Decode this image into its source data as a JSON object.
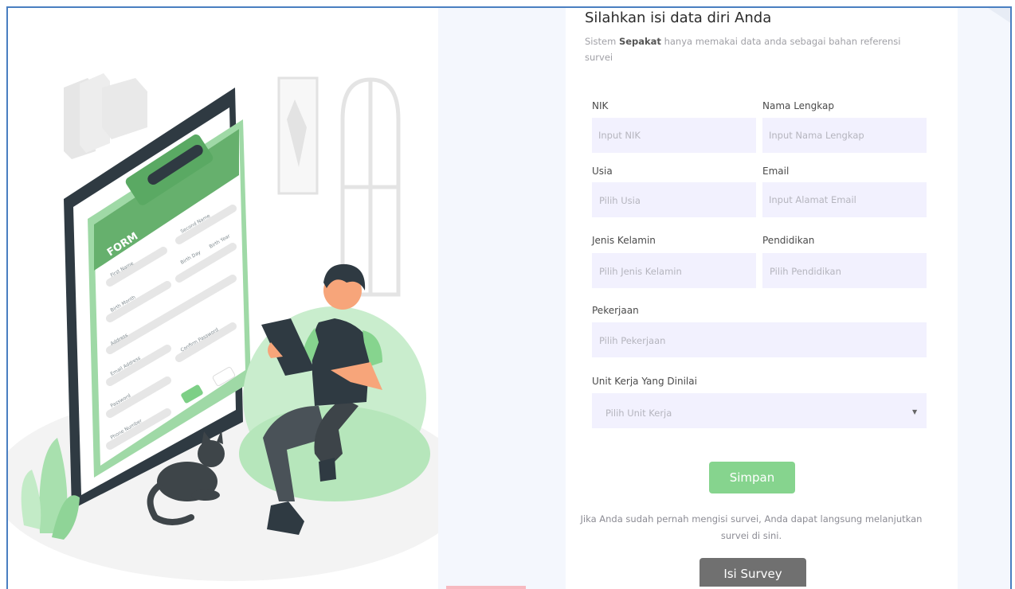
{
  "form": {
    "title": "Silahkan isi data diri Anda",
    "subtitle_prefix": "Sistem ",
    "subtitle_brand": "Sepakat",
    "subtitle_suffix": " hanya memakai data anda sebagai bahan referensi survei",
    "fields": {
      "nik": {
        "label": "NIK",
        "placeholder": "Input NIK"
      },
      "nama": {
        "label": "Nama Lengkap",
        "placeholder": "Input Nama Lengkap"
      },
      "usia": {
        "label": "Usia",
        "placeholder": "Pilih Usia"
      },
      "email": {
        "label": "Email",
        "placeholder": "Input Alamat Email"
      },
      "jenis_kelamin": {
        "label": "Jenis Kelamin",
        "placeholder": "Pilih Jenis Kelamin"
      },
      "pendidikan": {
        "label": "Pendidikan",
        "placeholder": "Pilih Pendidikan"
      },
      "pekerjaan": {
        "label": "Pekerjaan",
        "placeholder": "Pilih Pekerjaan"
      },
      "unit_kerja": {
        "label": "Unit Kerja Yang Dinilai",
        "placeholder": "Pilih Unit Kerja"
      }
    },
    "save_label": "Simpan",
    "note": "Jika Anda sudah pernah mengisi survei, Anda dapat langsung melanjutkan survei di sini.",
    "survey_label": "Isi Survey"
  },
  "illustration": {
    "form_heading": "FORM",
    "field_labels": [
      "First Name",
      "Second Name",
      "Birth Month",
      "Birth Day",
      "Birth Year",
      "Address",
      "Email Address",
      "Confirm Password",
      "Password",
      "Phone Number"
    ]
  },
  "colors": {
    "accent_green": "#86d48e",
    "field_bg": "#f2f1fe",
    "survey_button": "#707070",
    "frame_border": "#4a7fc1"
  }
}
